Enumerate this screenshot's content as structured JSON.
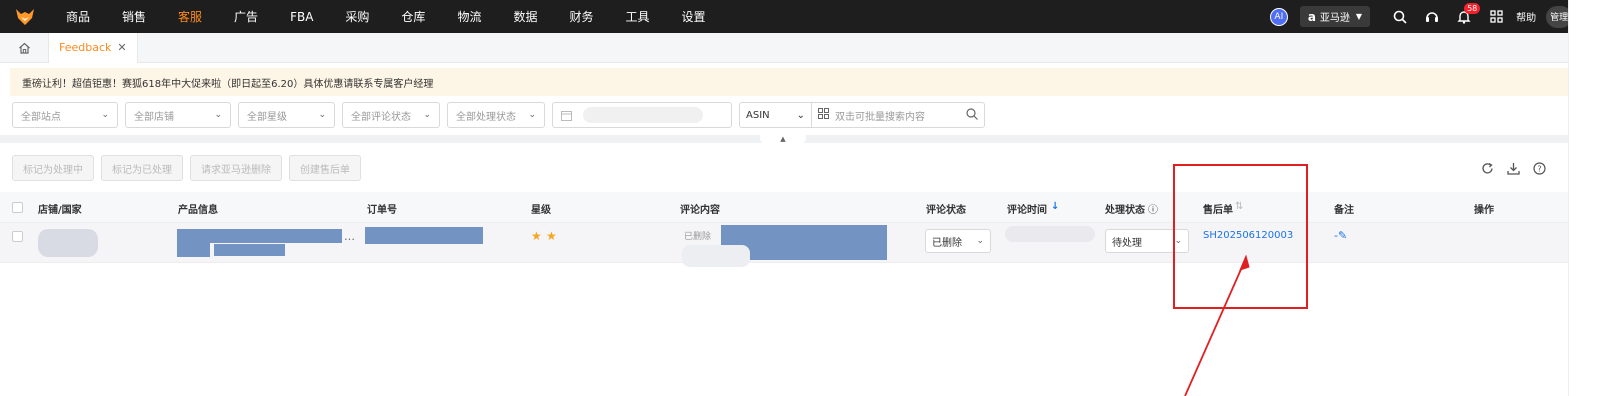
{
  "nav": {
    "items": [
      "商品",
      "销售",
      "客服",
      "广告",
      "FBA",
      "采购",
      "仓库",
      "物流",
      "数据",
      "财务",
      "工具",
      "设置"
    ],
    "active_index": 2,
    "ai_label": "AI",
    "store": "亚马逊",
    "notification_count": "58",
    "help": "帮助",
    "user": "管理"
  },
  "tabs": {
    "feedback": "Feedback"
  },
  "notice": {
    "text": "重磅让利！超值钜惠！赛狐618年中大促来啦（即日起至6.20）具体优惠请联系专属客户经理"
  },
  "filters": {
    "site": "全部站点",
    "shop": "全部店铺",
    "rating": "全部星级",
    "review_status": "全部评论状态",
    "process_status": "全部处理状态",
    "search_type": "ASIN",
    "search_placeholder": "双击可批量搜索内容"
  },
  "actions": {
    "mark_processing": "标记为处理中",
    "mark_processed": "标记为已处理",
    "request_delete": "请求亚马逊删除",
    "create_aftersale": "创建售后单"
  },
  "table": {
    "headers": {
      "shop_country": "店铺/国家",
      "product": "产品信息",
      "order": "订单号",
      "rating": "星级",
      "content": "评论内容",
      "review_status": "评论状态",
      "review_time": "评论时间",
      "process_status": "处理状态",
      "aftersale": "售后单",
      "note": "备注",
      "operation": "操作"
    },
    "row": {
      "stars": 2,
      "deleted_tag": "已删除",
      "review_status": "已删除",
      "process_status": "待处理",
      "aftersale_id": "SH202506120003",
      "note": "-"
    }
  },
  "colors": {
    "accent": "#ff8a1f",
    "link": "#1a73e8",
    "annotation": "#e02020"
  }
}
